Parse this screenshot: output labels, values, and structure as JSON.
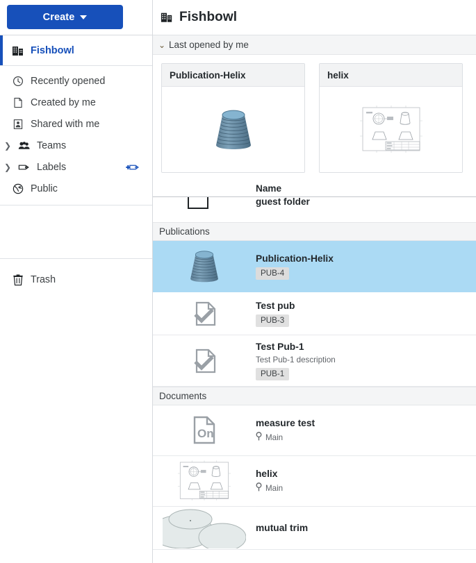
{
  "sidebar": {
    "create_button": {
      "label": "Create",
      "icon": "caret-down-icon",
      "color": "#1750ba"
    },
    "active_item": {
      "label": "Fishbowl",
      "icon": "company-building-icon",
      "color": "#1750ba"
    },
    "items": [
      {
        "label": "Recently opened",
        "icon": "clock-icon",
        "chevron": false
      },
      {
        "label": "Created by me",
        "icon": "document-icon",
        "chevron": false
      },
      {
        "label": "Shared with me",
        "icon": "shared-person-icon",
        "chevron": false
      },
      {
        "label": "Teams",
        "icon": "teams-people-icon",
        "chevron": true
      },
      {
        "label": "Labels",
        "icon": "label-tag-icon",
        "chevron": true,
        "tail_icon": "add-label-icon"
      },
      {
        "label": "Public",
        "icon": "globe-icon",
        "chevron": false
      }
    ],
    "trash": {
      "label": "Trash",
      "icon": "trash-icon"
    }
  },
  "header": {
    "title": "Fishbowl",
    "icon": "company-building-icon"
  },
  "recent_section": {
    "label": "Last opened by me",
    "chevron": "⌄",
    "expanded": true
  },
  "recent_cards": [
    {
      "title": "Publication-Helix",
      "thumbnail": "cone-3d-blue"
    },
    {
      "title": "helix",
      "thumbnail": "drawing-sheet"
    }
  ],
  "list": {
    "columns": [
      "Name"
    ],
    "folder_row": {
      "name": "guest folder",
      "icon": "folder-icon"
    },
    "groups": [
      {
        "title": "Publications",
        "rows": [
          {
            "name": "Publication-Helix",
            "badge": "PUB-4",
            "thumbnail": "cone-3d-blue",
            "selected": true
          },
          {
            "name": "Test pub",
            "badge": "PUB-3",
            "thumbnail": "doc-check-icon",
            "selected": false
          },
          {
            "name": "Test Pub-1",
            "description": "Test Pub-1 description",
            "badge": "PUB-1",
            "thumbnail": "doc-check-icon",
            "selected": false
          }
        ]
      },
      {
        "title": "Documents",
        "rows": [
          {
            "name": "measure test",
            "location": "Main",
            "location_icon": "pin-icon",
            "thumbnail": "onshape-doc-icon",
            "selected": false
          },
          {
            "name": "helix",
            "location": "Main",
            "location_icon": "pin-icon",
            "thumbnail": "drawing-sheet",
            "selected": false
          },
          {
            "name": "mutual trim",
            "thumbnail": "ellipses-sketch",
            "selected": false
          }
        ]
      }
    ]
  },
  "colors": {
    "accent": "#1750ba",
    "selected_row": "#abdaf4",
    "group_header_bg": "#f4f5f6",
    "badge_bg": "#e0e0e0"
  }
}
